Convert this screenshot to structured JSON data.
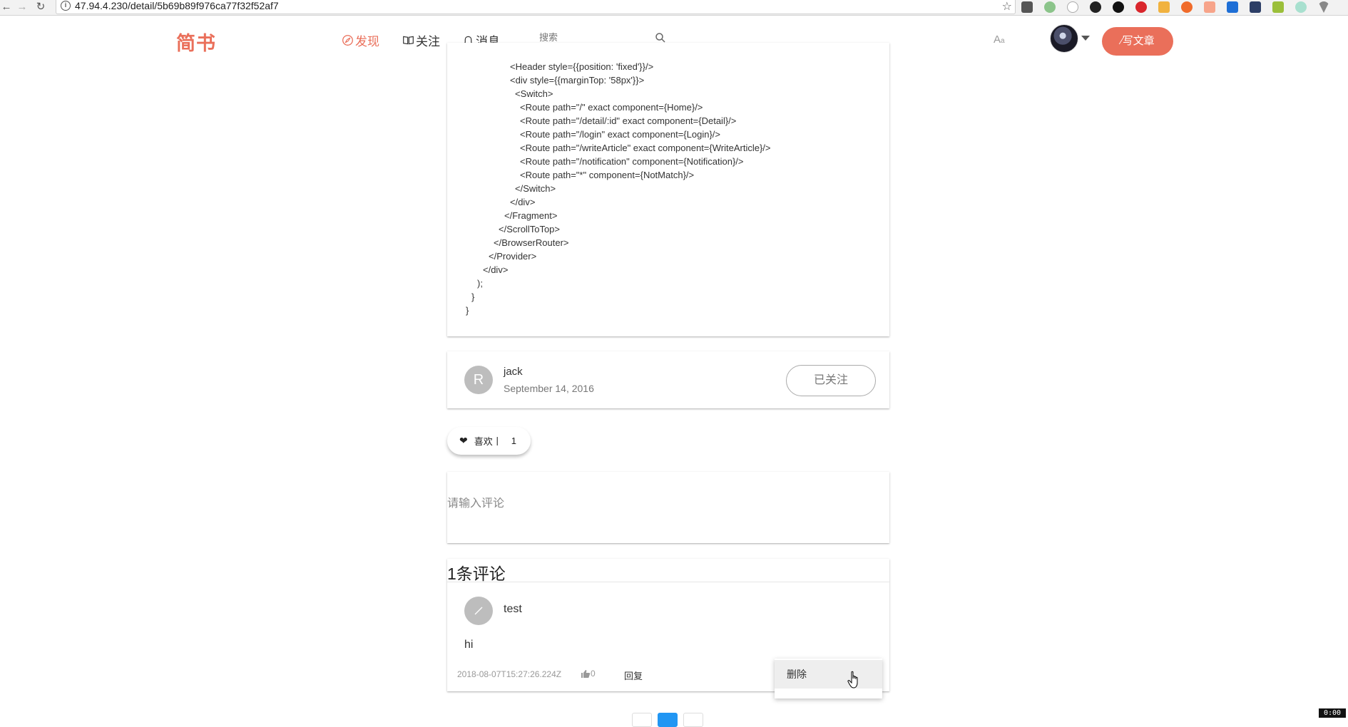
{
  "browser": {
    "url": "47.94.4.230/detail/5b69b89f976ca77f32f52af7"
  },
  "header": {
    "logo": "简书",
    "nav": {
      "discover": "发现",
      "follow": "关注",
      "messages": "消息"
    },
    "search_placeholder": "搜索",
    "font_toggle": "A",
    "font_toggle_small": "a",
    "write_label": "写文章"
  },
  "article": {
    "code_lines": [
      "<Header style={{position: 'fixed'}}/>",
      "<div style={{marginTop: '58px'}}>",
      "<Switch>",
      "<Route path=\"/\" exact component={Home}/>",
      "<Route path=\"/detail/:id\" exact component={Detail}/>",
      "<Route path=\"/login\" exact component={Login}/>",
      "<Route path=\"/writeArticle\" exact component={WriteArticle}/>",
      "<Route path=\"/notification\" component={Notification}/>",
      "<Route path=\"*\" component={NotMatch}/>",
      "</Switch>",
      "</div>",
      "</Fragment>",
      "</ScrollToTop>",
      "</BrowserRouter>",
      "</Provider>",
      "</div>",
      ");",
      "}",
      "}"
    ]
  },
  "author": {
    "avatar_letter": "R",
    "name": "jack",
    "date": "September 14, 2016",
    "follow_label": "已关注"
  },
  "like": {
    "label": "喜欢丨",
    "count": "1"
  },
  "comment_input": {
    "placeholder": "请输入评论"
  },
  "comments": {
    "title": "1条评论",
    "items": [
      {
        "user": "test",
        "text": "hi",
        "time": "2018-08-07T15:27:26.224Z",
        "likes": "0",
        "reply_label": "回复"
      }
    ]
  },
  "popover": {
    "delete_label": "删除"
  },
  "recording_badge": "0:00",
  "colors": {
    "brand": "#ea6f5a",
    "pagination_active": "#2196f3"
  }
}
